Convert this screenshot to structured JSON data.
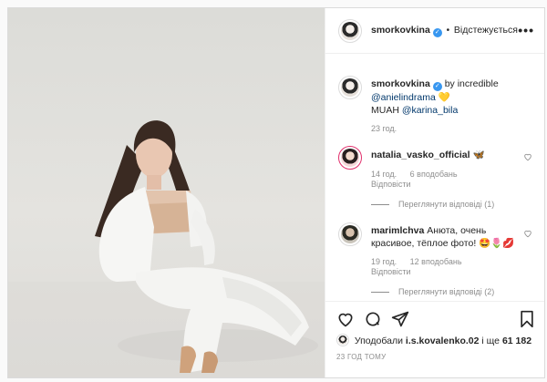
{
  "post": {
    "author": "smorkovkina",
    "separator": "•",
    "follow_label": "Відстежується",
    "more_label": "•••"
  },
  "caption": {
    "author": "smorkovkina",
    "text_prefix": "by incredible",
    "mention1": "@anielindrama",
    "emoji1": "💛",
    "line2_text": "MUAH",
    "mention2": "@karina_bila",
    "time": "23 год."
  },
  "comments": [
    {
      "author": "natalia_vasko_official",
      "text": "🦋",
      "time": "14 год.",
      "likes": "6 вподобань",
      "reply_label": "Відповісти",
      "view_replies": "Переглянути відповіді (1)"
    },
    {
      "author": "marimlchva",
      "text": "Анюта, очень красивое, тёплое фото! 🤩🌷💋",
      "time": "19 год.",
      "likes": "12 вподобань",
      "reply_label": "Відповісти",
      "view_replies": "Переглянути відповіді (2)"
    }
  ],
  "likes": {
    "prefix": "Уподобали",
    "user": "i.s.kovalenko.02",
    "middle": "і ще",
    "count": "61 182"
  },
  "time_ago": "23 ГОД ТОМУ",
  "colors": {
    "verified": "#3897f0",
    "link": "#00376b",
    "muted": "#8e8e8e"
  }
}
